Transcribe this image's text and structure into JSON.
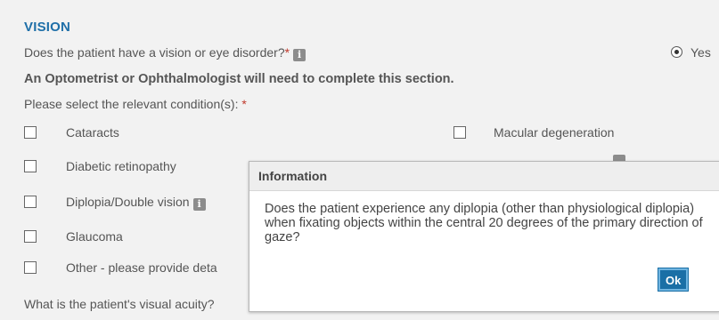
{
  "section": {
    "title": "VISION"
  },
  "question1": {
    "text": "Does the patient have a vision or eye disorder?",
    "required_mark": "*",
    "info_icon": "i",
    "answer_label": "Yes"
  },
  "note": "An Optometrist or Ophthalmologist will need to complete this section.",
  "conditions": {
    "label": "Please select the relevant condition(s):",
    "required_mark": "*",
    "left": [
      "Cataracts",
      "Diabetic retinopathy",
      "Diplopia/Double vision",
      "Glaucoma",
      "Other - please provide deta"
    ],
    "right": [
      "Macular degeneration"
    ],
    "info_icon": "i"
  },
  "acuity_question": "What is the patient's visual acuity?",
  "dialog": {
    "title": "Information",
    "body": "Does the patient experience any diplopia (other than physiological diplopia) when fixating objects within the central 20 degrees of the primary direction of gaze?",
    "ok_label": "Ok"
  },
  "colors": {
    "accent": "#1f6fa8",
    "required": "#c0392b",
    "button": "#1a6fa6"
  }
}
